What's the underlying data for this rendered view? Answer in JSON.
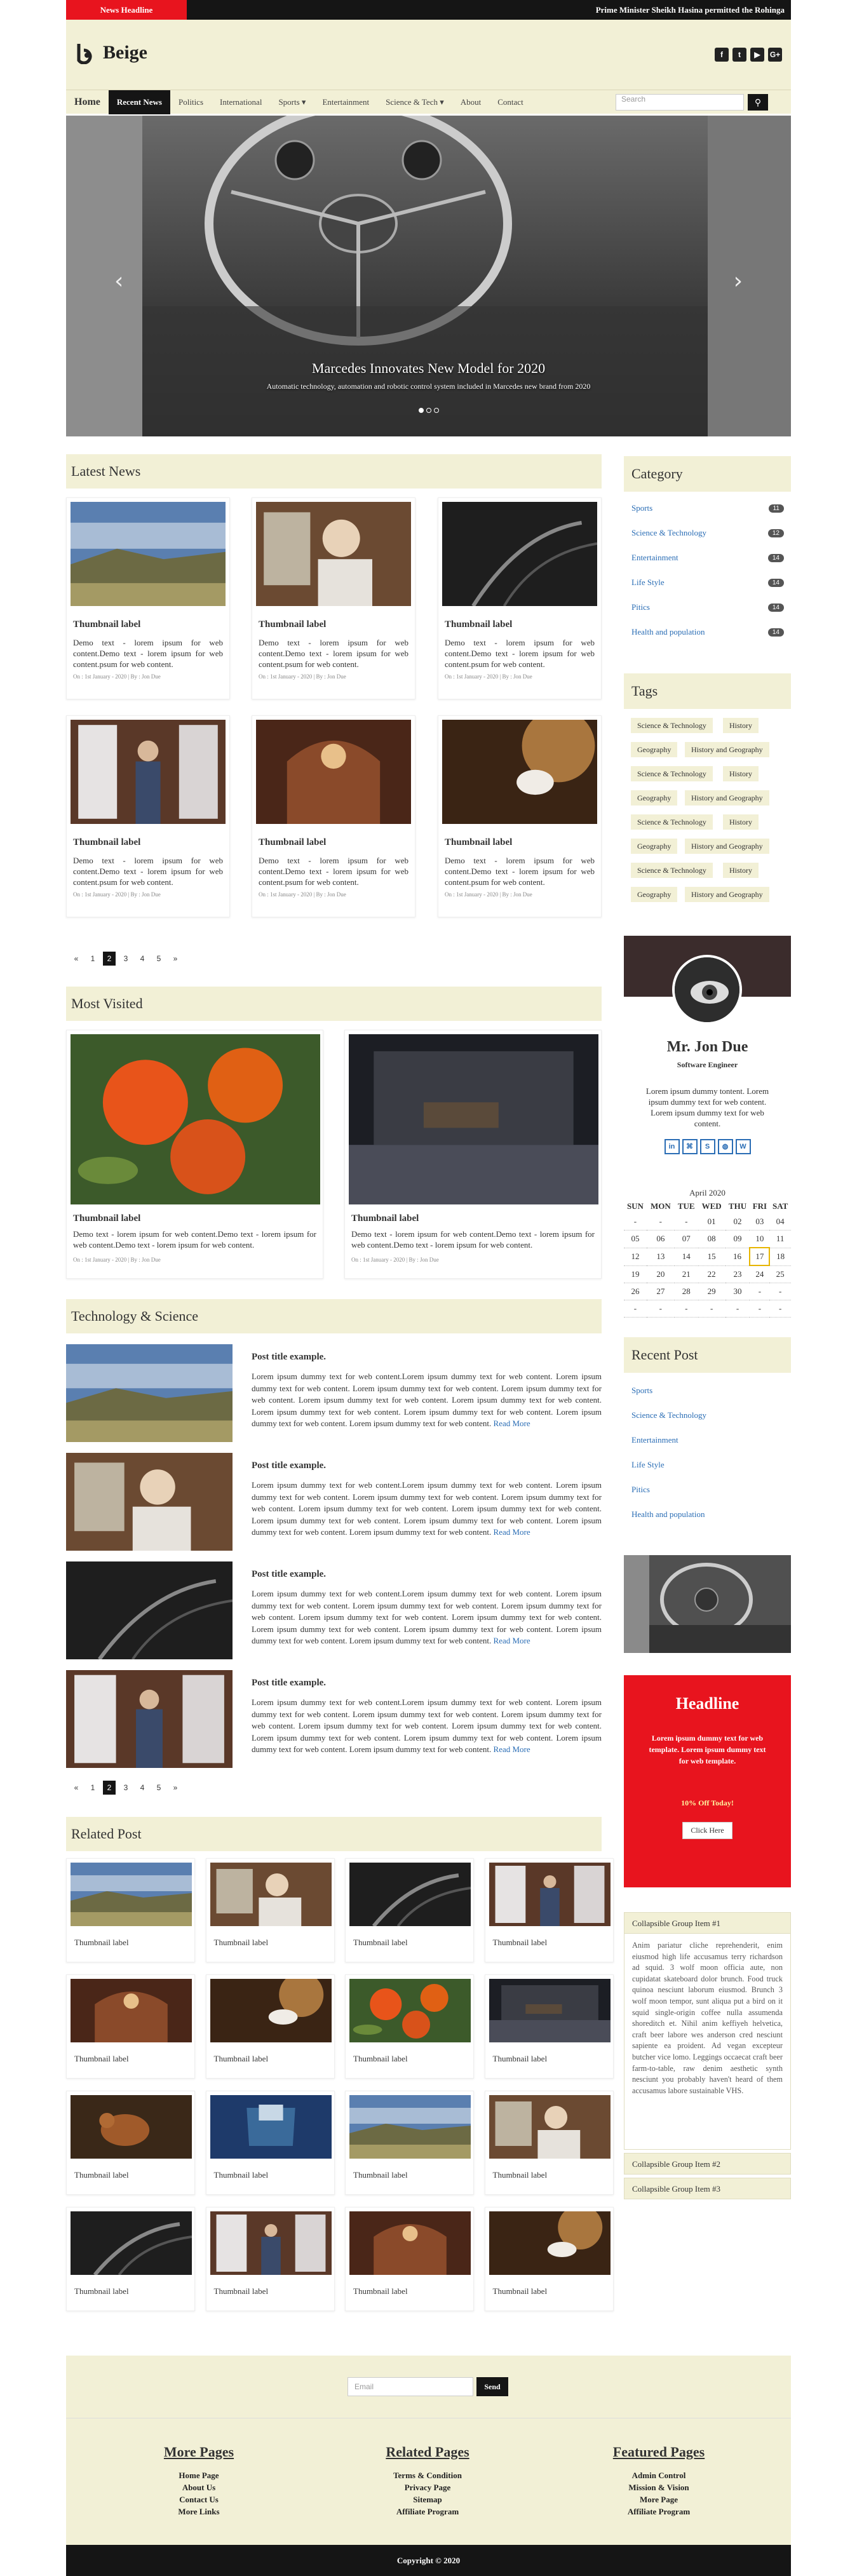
{
  "topbar": {
    "headline_label": "News Headline",
    "ticker": "Prime Minister Sheikh Hasina permitted the Rohinga"
  },
  "brand": {
    "name": "Beige"
  },
  "social": [
    {
      "icon": "facebook-icon",
      "glyph": "f"
    },
    {
      "icon": "twitter-icon",
      "glyph": "t"
    },
    {
      "icon": "youtube-icon",
      "glyph": "▶"
    },
    {
      "icon": "google-plus-icon",
      "glyph": "G+"
    }
  ],
  "nav": {
    "home": "Home",
    "items": [
      "Recent News",
      "Politics",
      "International",
      "Sports ▾",
      "Entertainment",
      "Science & Tech ▾",
      "About",
      "Contact"
    ],
    "search_placeholder": "Search"
  },
  "hero": {
    "title": "Marcedes Innovates New Model for 2020",
    "subtitle": "Automatic technology, automation and robotic control system included in Marcedes new brand from 2020",
    "prev": "‹",
    "next": "›"
  },
  "latest": {
    "heading": "Latest News",
    "cards": [
      {
        "title": "Thumbnail label",
        "text": "Demo text - lorem ipsum for web content.Demo text - lorem ipsum for web content.psum for web content.",
        "meta": "On : 1st January - 2020 | By : Jon Due",
        "img": "landscape"
      },
      {
        "title": "Thumbnail label",
        "text": "Demo text - lorem ipsum for web content.Demo text - lorem ipsum for web content.psum for web content.",
        "meta": "On : 1st January - 2020 | By : Jon Due",
        "img": "child"
      },
      {
        "title": "Thumbnail label",
        "text": "Demo text - lorem ipsum for web content.Demo text - lorem ipsum for web content.psum for web content.",
        "meta": "On : 1st January - 2020 | By : Jon Due",
        "img": "dark"
      },
      {
        "title": "Thumbnail label",
        "text": "Demo text - lorem ipsum for web content.Demo text - lorem ipsum for web content.psum for web content.",
        "meta": "On : 1st January - 2020 | By : Jon Due",
        "img": "woman"
      },
      {
        "title": "Thumbnail label",
        "text": "Demo text - lorem ipsum for web content.Demo text - lorem ipsum for web content.psum for web content.",
        "meta": "On : 1st January - 2020 | By : Jon Due",
        "img": "church"
      },
      {
        "title": "Thumbnail label",
        "text": "Demo text - lorem ipsum for web content.Demo text - lorem ipsum for web content.psum for web content.",
        "meta": "On : 1st January - 2020 | By : Jon Due",
        "img": "horse"
      }
    ]
  },
  "pager": [
    "«",
    "1",
    "2",
    "3",
    "4",
    "5",
    "»"
  ],
  "pager_active": "2",
  "most": {
    "heading": "Most Visited",
    "cards": [
      {
        "title": "Thumbnail label",
        "text": "Demo text - lorem ipsum for web content.Demo text - lorem ipsum for web content.Demo text - lorem ipsum for web content.",
        "meta": "On : 1st January - 2020 | By : Jon Due",
        "img": "oranges"
      },
      {
        "title": "Thumbnail label",
        "text": "Demo text - lorem ipsum for web content.Demo text - lorem ipsum for web content.Demo text - lorem ipsum for web content.",
        "meta": "On : 1st January - 2020 | By : Jon Due",
        "img": "room"
      }
    ]
  },
  "tech": {
    "heading": "Technology & Science",
    "read_more": "Read More",
    "posts": [
      {
        "title": "Post title example.",
        "text": "Lorem ipsum dummy text for web content.Lorem ipsum dummy text for web content. Lorem ipsum dummy text for web content. Lorem ipsum dummy text for web content. Lorem ipsum dummy text for web content. Lorem ipsum dummy text for web content. Lorem ipsum dummy text for web content. Lorem ipsum dummy text for web content. Lorem ipsum dummy text for web content. Lorem ipsum dummy text for web content. Lorem ipsum dummy text for web content.",
        "img": "landscape"
      },
      {
        "title": "Post title example.",
        "text": "Lorem ipsum dummy text for web content.Lorem ipsum dummy text for web content. Lorem ipsum dummy text for web content. Lorem ipsum dummy text for web content. Lorem ipsum dummy text for web content. Lorem ipsum dummy text for web content. Lorem ipsum dummy text for web content. Lorem ipsum dummy text for web content. Lorem ipsum dummy text for web content. Lorem ipsum dummy text for web content. Lorem ipsum dummy text for web content.",
        "img": "child"
      },
      {
        "title": "Post title example.",
        "text": "Lorem ipsum dummy text for web content.Lorem ipsum dummy text for web content. Lorem ipsum dummy text for web content. Lorem ipsum dummy text for web content. Lorem ipsum dummy text for web content. Lorem ipsum dummy text for web content. Lorem ipsum dummy text for web content. Lorem ipsum dummy text for web content. Lorem ipsum dummy text for web content. Lorem ipsum dummy text for web content. Lorem ipsum dummy text for web content.",
        "img": "dark"
      },
      {
        "title": "Post title example.",
        "text": "Lorem ipsum dummy text for web content.Lorem ipsum dummy text for web content. Lorem ipsum dummy text for web content. Lorem ipsum dummy text for web content. Lorem ipsum dummy text for web content. Lorem ipsum dummy text for web content. Lorem ipsum dummy text for web content. Lorem ipsum dummy text for web content. Lorem ipsum dummy text for web content. Lorem ipsum dummy text for web content. Lorem ipsum dummy text for web content.",
        "img": "woman"
      }
    ]
  },
  "related": {
    "heading": "Related Post",
    "items": [
      {
        "label": "Thumbnail label",
        "img": "landscape"
      },
      {
        "label": "Thumbnail label",
        "img": "child"
      },
      {
        "label": "Thumbnail label",
        "img": "dark"
      },
      {
        "label": "Thumbnail label",
        "img": "woman"
      },
      {
        "label": "Thumbnail label",
        "img": "church"
      },
      {
        "label": "Thumbnail label",
        "img": "horse"
      },
      {
        "label": "Thumbnail label",
        "img": "oranges"
      },
      {
        "label": "Thumbnail label",
        "img": "room"
      },
      {
        "label": "Thumbnail label",
        "img": "squirrel"
      },
      {
        "label": "Thumbnail label",
        "img": "jeans"
      },
      {
        "label": "Thumbnail label",
        "img": "landscape"
      },
      {
        "label": "Thumbnail label",
        "img": "child"
      },
      {
        "label": "Thumbnail label",
        "img": "dark"
      },
      {
        "label": "Thumbnail label",
        "img": "woman"
      },
      {
        "label": "Thumbnail label",
        "img": "church"
      },
      {
        "label": "Thumbnail label",
        "img": "horse"
      }
    ]
  },
  "category": {
    "heading": "Category",
    "items": [
      {
        "label": "Sports",
        "count": "11"
      },
      {
        "label": "Science & Technology",
        "count": "12"
      },
      {
        "label": "Entertainment",
        "count": "14"
      },
      {
        "label": "Life Style",
        "count": "14"
      },
      {
        "label": "Pitics",
        "count": "14"
      },
      {
        "label": "Health and population",
        "count": "14"
      }
    ]
  },
  "tags": {
    "heading": "Tags",
    "rows": [
      [
        "Science & Technology",
        "History"
      ],
      [
        "Geography",
        "History and Geography"
      ],
      [
        "Science & Technology",
        "History"
      ],
      [
        "Geography",
        "History and Geography"
      ],
      [
        "Science & Technology",
        "History"
      ],
      [
        "Geography",
        "History and Geography"
      ],
      [
        "Science & Technology",
        "History"
      ],
      [
        "Geography",
        "History and Geography"
      ]
    ]
  },
  "profile": {
    "name": "Mr. Jon Due",
    "role": "Software Engineer",
    "bio": "Lorem ipsum dummy tontent. Lorem ipsum dummy text for web content. Lorem ipsum dummy text for web content.",
    "icons": [
      "linkedin-icon",
      "github-icon",
      "skype-icon",
      "dribbble-icon",
      "wordpress-icon"
    ],
    "glyphs": [
      "in",
      "⌘",
      "S",
      "◍",
      "W"
    ]
  },
  "calendar": {
    "title": "April 2020",
    "days": [
      "SUN",
      "MON",
      "TUE",
      "WED",
      "THU",
      "FRI",
      "SAT"
    ],
    "weeks": [
      [
        "-",
        "-",
        "-",
        "01",
        "02",
        "03",
        "04"
      ],
      [
        "05",
        "06",
        "07",
        "08",
        "09",
        "10",
        "11"
      ],
      [
        "12",
        "13",
        "14",
        "15",
        "16",
        "17",
        "18"
      ],
      [
        "19",
        "20",
        "21",
        "22",
        "23",
        "24",
        "25"
      ],
      [
        "26",
        "27",
        "28",
        "29",
        "30",
        "-",
        "-"
      ],
      [
        "-",
        "-",
        "-",
        "-",
        "-",
        "-",
        "-"
      ]
    ],
    "today": "17"
  },
  "recent": {
    "heading": "Recent Post",
    "items": [
      "Sports",
      "Science & Technology",
      "Entertainment",
      "Life Style",
      "Pitics",
      "Health and population"
    ]
  },
  "promo": {
    "title": "Headline",
    "text": "Lorem ipsum dummy text for web template. Lorem ipsum dummy text for web template.",
    "offer": "10% Off Today!",
    "button": "Click Here"
  },
  "collapse": {
    "item1": "Collapsible Group Item #1",
    "body": "Anim pariatur cliche reprehenderit, enim eiusmod high life accusamus terry richardson ad squid. 3 wolf moon officia aute, non cupidatat skateboard dolor brunch. Food truck quinoa nesciunt laborum eiusmod. Brunch 3 wolf moon tempor, sunt aliqua put a bird on it squid single-origin coffee nulla assumenda shoreditch et. Nihil anim keffiyeh helvetica, craft beer labore wes anderson cred nesciunt sapiente ea proident. Ad vegan excepteur butcher vice lomo. Leggings occaecat craft beer farm-to-table, raw denim aesthetic synth nesciunt you probably haven't heard of them accusamus labore sustainable VHS.",
    "item2": "Collapsible Group Item #2",
    "item3": "Collapsible Group Item #3"
  },
  "newsletter": {
    "placeholder": "Email",
    "button": "Send"
  },
  "footer": {
    "cols": [
      {
        "title": "More Pages",
        "links": [
          "Home Page",
          "About Us",
          "Contact Us",
          "More Links"
        ]
      },
      {
        "title": "Related Pages",
        "links": [
          "Terms & Condition",
          "Privacy Page",
          "Sitemap",
          "Affiliate Program"
        ]
      },
      {
        "title": "Featured Pages",
        "links": [
          "Admin Control",
          "Mission & Vision",
          "More Page",
          "Affiliate Program"
        ]
      }
    ],
    "copyright": "Copyright © 2020"
  }
}
